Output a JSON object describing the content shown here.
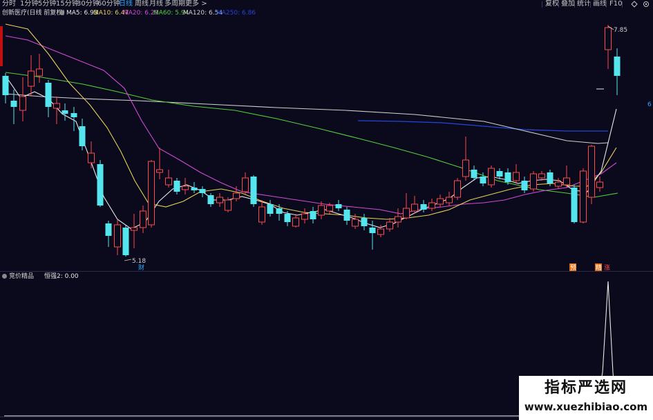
{
  "toolbar": {
    "periods": [
      "分时",
      "1分钟",
      "5分钟",
      "15分钟",
      "30分钟",
      "60分钟",
      "日线",
      "周线",
      "月线",
      "多周期",
      "更多"
    ],
    "active_period": "日线",
    "more_suffix": ">",
    "right": [
      "复权",
      "叠加",
      "统计",
      "画线",
      "F10"
    ],
    "right_icons": [
      "diamond-icon",
      "settings-icon"
    ]
  },
  "stock": {
    "title": "创新医疗(日线 前复权)",
    "ma": [
      {
        "label": "MA5: 6.93",
        "color": "#e8e8e8"
      },
      {
        "label": "MA10: 6.47",
        "color": "#e6d35a"
      },
      {
        "label": "MA20: 6.29",
        "color": "#d24bd6"
      },
      {
        "label": "MA60: 5.94",
        "color": "#53d03b"
      },
      {
        "label": "MA120: 6.54",
        "color": "#d0d0d0"
      },
      {
        "label": "MA250: 6.86",
        "color": "#2346d8"
      }
    ]
  },
  "annotations": {
    "high": "7.85",
    "low": "5.18",
    "low_tag": "财",
    "right_price": "6",
    "tag_1": "预",
    "tag_2": "精",
    "tag_3": "涨"
  },
  "indicator": {
    "name": "竞价精品",
    "value": "恒强2: 0.00"
  },
  "watermark": {
    "line1": "指标严选网",
    "line2": "www.xuezhibiao.com"
  },
  "colors": {
    "up": "#ff4b4b",
    "down": "#54e5ef",
    "bg": "#0b0a1c",
    "accent": "#2ea8ff"
  }
}
